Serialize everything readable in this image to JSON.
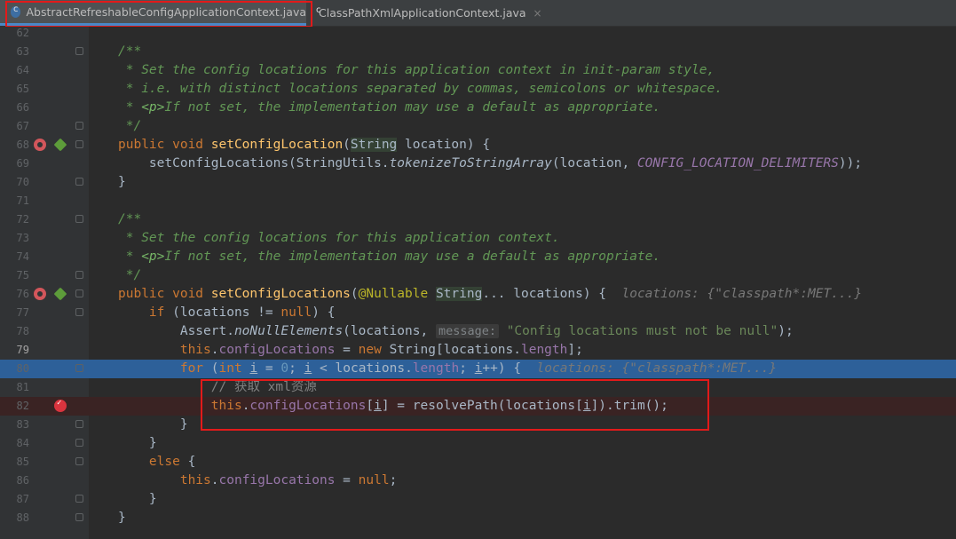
{
  "tabs": [
    {
      "label": "AbstractRefreshableConfigApplicationContext.java",
      "close": "",
      "active": true
    },
    {
      "label": "ClassPathXmlApplicationContext.java",
      "close": "×",
      "active": false
    }
  ],
  "editor": {
    "lines": [
      {
        "num": "62",
        "tokens": []
      },
      {
        "num": "63",
        "tokens": [
          {
            "t": "/**",
            "c": "cm"
          }
        ]
      },
      {
        "num": "64",
        "tokens": [
          {
            "t": " * Set the config locations for this application context in init-param style,",
            "c": "cm"
          }
        ]
      },
      {
        "num": "65",
        "tokens": [
          {
            "t": " * i.e. with distinct locations separated by commas, semicolons or whitespace.",
            "c": "cm"
          }
        ]
      },
      {
        "num": "66",
        "tokens": [
          {
            "t": " * ",
            "c": "cm"
          },
          {
            "t": "<p>",
            "c": "tag"
          },
          {
            "t": "If not set, the implementation may use a default as appropriate.",
            "c": "cm"
          }
        ]
      },
      {
        "num": "67",
        "tokens": [
          {
            "t": " */",
            "c": "cm"
          }
        ]
      },
      {
        "num": "68",
        "tokens": [
          {
            "t": "public void ",
            "c": "kw"
          },
          {
            "t": "setConfigLocation",
            "c": "fn"
          },
          {
            "t": "("
          },
          {
            "t": "String",
            "c": "typ"
          },
          {
            "t": " location) {"
          }
        ]
      },
      {
        "num": "69",
        "tokens": [
          {
            "t": "    setConfigLocations(StringUtils."
          },
          {
            "t": "tokenizeToStringArray",
            "c": "sm"
          },
          {
            "t": "(location, "
          },
          {
            "t": "CONFIG_LOCATION_DELIMITERS",
            "c": "cst"
          },
          {
            "t": "));"
          }
        ]
      },
      {
        "num": "70",
        "tokens": [
          {
            "t": "}"
          }
        ]
      },
      {
        "num": "71",
        "tokens": []
      },
      {
        "num": "72",
        "tokens": [
          {
            "t": "/**",
            "c": "cm"
          }
        ]
      },
      {
        "num": "73",
        "tokens": [
          {
            "t": " * Set the config locations for this application context.",
            "c": "cm"
          }
        ]
      },
      {
        "num": "74",
        "tokens": [
          {
            "t": " * ",
            "c": "cm"
          },
          {
            "t": "<p>",
            "c": "tag"
          },
          {
            "t": "If not set, the implementation may use a default as appropriate.",
            "c": "cm"
          }
        ]
      },
      {
        "num": "75",
        "tokens": [
          {
            "t": " */",
            "c": "cm"
          }
        ]
      },
      {
        "num": "76",
        "tokens": [
          {
            "t": "public void ",
            "c": "kw"
          },
          {
            "t": "setConfigLocations",
            "c": "fn"
          },
          {
            "t": "("
          },
          {
            "t": "@Nullable",
            "c": "an"
          },
          {
            "t": " "
          },
          {
            "t": "String",
            "c": "typ"
          },
          {
            "t": "... locations) {  "
          },
          {
            "t": "locations: {\"classpath*:MET...}",
            "c": "hint"
          }
        ]
      },
      {
        "num": "77",
        "tokens": [
          {
            "t": "    "
          },
          {
            "t": "if",
            "c": "kw"
          },
          {
            "t": " (locations != "
          },
          {
            "t": "null",
            "c": "kw"
          },
          {
            "t": ") {"
          }
        ]
      },
      {
        "num": "78",
        "tokens": [
          {
            "t": "        Assert."
          },
          {
            "t": "noNullElements",
            "c": "sm"
          },
          {
            "t": "(locations, "
          },
          {
            "t": "message:",
            "c": "ph"
          },
          {
            "t": " "
          },
          {
            "t": "\"Config locations must not be null\"",
            "c": "str"
          },
          {
            "t": ");"
          }
        ]
      },
      {
        "num": "79",
        "tokens": [
          {
            "t": "        "
          },
          {
            "t": "this",
            "c": "kw"
          },
          {
            "t": "."
          },
          {
            "t": "configLocations",
            "c": "fld"
          },
          {
            "t": " = "
          },
          {
            "t": "new ",
            "c": "kw"
          },
          {
            "t": "String[locations."
          },
          {
            "t": "length",
            "c": "fld"
          },
          {
            "t": "];"
          }
        ]
      },
      {
        "num": "80",
        "tokens": [
          {
            "t": "        "
          },
          {
            "t": "for",
            "c": "kw"
          },
          {
            "t": " ("
          },
          {
            "t": "int ",
            "c": "kw"
          },
          {
            "t": "i",
            "c": "ul"
          },
          {
            "t": " = "
          },
          {
            "t": "0",
            "c": "nm"
          },
          {
            "t": "; "
          },
          {
            "t": "i",
            "c": "ul"
          },
          {
            "t": " < locations."
          },
          {
            "t": "length",
            "c": "fld"
          },
          {
            "t": "; "
          },
          {
            "t": "i",
            "c": "ul"
          },
          {
            "t": "++) {  "
          },
          {
            "t": "locations: {\"classpath*:MET...}",
            "c": "hint"
          }
        ]
      },
      {
        "num": "81",
        "tokens": [
          {
            "t": "            "
          },
          {
            "t": "// 获取 xml资源",
            "c": "lc"
          }
        ]
      },
      {
        "num": "82",
        "tokens": [
          {
            "t": "            "
          },
          {
            "t": "this",
            "c": "kw"
          },
          {
            "t": "."
          },
          {
            "t": "configLocations",
            "c": "fld"
          },
          {
            "t": "["
          },
          {
            "t": "i",
            "c": "ul"
          },
          {
            "t": "] = resolvePath(locations["
          },
          {
            "t": "i",
            "c": "ul"
          },
          {
            "t": "]).trim();"
          }
        ]
      },
      {
        "num": "83",
        "tokens": [
          {
            "t": "        }"
          }
        ]
      },
      {
        "num": "84",
        "tokens": [
          {
            "t": "    }"
          }
        ]
      },
      {
        "num": "85",
        "tokens": [
          {
            "t": "    "
          },
          {
            "t": "else",
            "c": "kw"
          },
          {
            "t": " {"
          }
        ]
      },
      {
        "num": "86",
        "tokens": [
          {
            "t": "        "
          },
          {
            "t": "this",
            "c": "kw"
          },
          {
            "t": "."
          },
          {
            "t": "configLocations",
            "c": "fld"
          },
          {
            "t": " = "
          },
          {
            "t": "null",
            "c": "kw"
          },
          {
            "t": ";"
          }
        ]
      },
      {
        "num": "87",
        "tokens": [
          {
            "t": "    }"
          }
        ]
      },
      {
        "num": "88",
        "tokens": [
          {
            "t": "}"
          }
        ]
      }
    ]
  }
}
